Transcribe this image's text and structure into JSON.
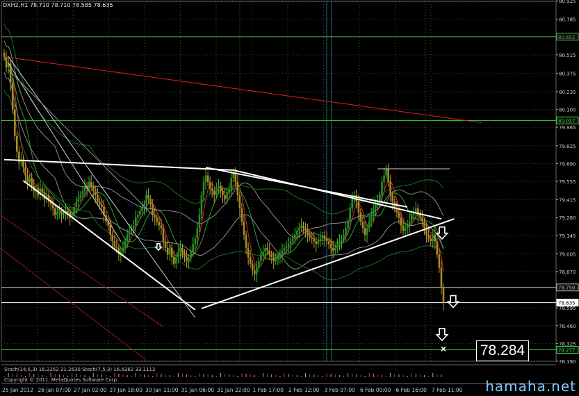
{
  "window": {
    "header": "DXH2,H1  78.710 78.710 78.585 78.635",
    "stoch_label": "Stoch(14,5,3) 16.2252 21.2630   Stoch(7,5,3) 16.6362 33.1112",
    "copyright": "Copyright © 2011, MetaQuotes Software Corp.",
    "watermark": "hamaha.net",
    "callout": "78.284"
  },
  "chart_data": {
    "type": "candlestick",
    "title": "DXH2,H1  78.710 78.710 78.585 78.635",
    "symbol": "DXH2",
    "timeframe": "H1",
    "last_bar": {
      "open": 78.71,
      "high": 78.71,
      "low": 78.585,
      "close": 78.635
    },
    "ylim": [
      78.19,
      80.92
    ],
    "y_ticks": [
      80.925,
      80.785,
      80.515,
      80.375,
      80.235,
      80.1,
      79.965,
      79.825,
      79.69,
      79.555,
      79.415,
      79.28,
      79.145,
      79.005,
      78.87,
      78.595,
      78.46,
      78.325,
      78.19
    ],
    "y_tick_labels": [
      "80.925",
      "80.785",
      "80.515",
      "80.375",
      "80.235",
      "80.100",
      "79.965",
      "79.825",
      "79.690",
      "79.555",
      "79.415",
      "79.280",
      "79.145",
      "79.005",
      "78.870",
      "78.595",
      "78.460",
      "78.325",
      "78.190"
    ],
    "price_markers": [
      {
        "value": 80.652,
        "label": "80.652",
        "color": "#55aa55"
      },
      {
        "value": 80.017,
        "label": "80.017",
        "color": "#33dd33"
      },
      {
        "value": 78.75,
        "label": "78.750",
        "color": "#bbbbbb"
      },
      {
        "value": 78.635,
        "label": "78.635",
        "color": "#ffffff"
      },
      {
        "value": 78.277,
        "label": "78.277",
        "color": "#33dd33"
      }
    ],
    "x_labels": [
      "25 Jan 2012",
      "26 Jan 07:00",
      "27 Jan 02:00",
      "27 Jan 18:00",
      "30 Jan 11:00",
      "31 Jan 06:00",
      "31 Jan 22:00",
      "1 Feb 17:00",
      "2 Feb 12:00",
      "3 Feb 07:00",
      "6 Feb 00:00",
      "6 Feb 16:00",
      "7 Feb 11:00"
    ],
    "bar_count": 206,
    "closes": [
      80.5,
      80.42,
      80.45,
      80.3,
      80.1,
      79.9,
      79.78,
      79.7,
      79.72,
      79.66,
      79.6,
      79.55,
      79.58,
      79.52,
      79.48,
      79.5,
      79.45,
      79.5,
      79.47,
      79.42,
      79.45,
      79.4,
      79.38,
      79.35,
      79.3,
      79.32,
      79.33,
      79.3,
      79.3,
      79.33,
      79.32,
      79.28,
      79.3,
      79.36,
      79.4,
      79.43,
      79.45,
      79.48,
      79.52,
      79.5,
      79.55,
      79.52,
      79.48,
      79.45,
      79.4,
      79.38,
      79.36,
      79.3,
      79.25,
      79.22,
      79.15,
      79.1,
      79.06,
      79.05,
      79.0,
      79.02,
      79.05,
      79.1,
      79.15,
      79.18,
      79.2,
      79.22,
      79.28,
      79.3,
      79.33,
      79.35,
      79.38,
      79.45,
      79.42,
      79.38,
      79.3,
      79.28,
      79.25,
      79.22,
      79.2,
      79.1,
      79.05,
      79.0,
      79.05,
      78.98,
      78.93,
      78.98,
      79.02,
      79.05,
      79.0,
      78.98,
      78.95,
      78.97,
      79.02,
      79.08,
      79.12,
      79.2,
      79.3,
      79.45,
      79.55,
      79.6,
      79.55,
      79.5,
      79.48,
      79.45,
      79.5,
      79.52,
      79.48,
      79.45,
      79.42,
      79.47,
      79.5,
      79.58,
      79.62,
      79.55,
      79.45,
      79.35,
      79.25,
      79.15,
      79.05,
      78.98,
      78.93,
      78.88,
      78.85,
      78.9,
      78.95,
      79.0,
      79.02,
      79.05,
      79.03,
      79.0,
      78.98,
      78.95,
      78.96,
      78.98,
      79.0,
      79.03,
      79.05,
      79.06,
      79.08,
      79.1,
      79.12,
      79.15,
      79.18,
      79.2,
      79.22,
      79.2,
      79.18,
      79.15,
      79.13,
      79.12,
      79.1,
      79.08,
      79.1,
      79.12,
      79.14,
      79.12,
      79.1,
      79.08,
      79.05,
      79.03,
      79.05,
      79.08,
      79.1,
      79.12,
      79.15,
      79.2,
      79.25,
      79.35,
      79.42,
      79.45,
      79.4,
      79.32,
      79.25,
      79.2,
      79.15,
      79.2,
      79.25,
      79.3,
      79.35,
      79.38,
      79.4,
      79.45,
      79.55,
      79.6,
      79.65,
      79.55,
      79.45,
      79.4,
      79.35,
      79.32,
      79.28,
      79.22,
      79.18,
      79.2,
      79.22,
      79.25,
      79.3,
      79.32,
      79.35,
      79.3,
      79.28,
      79.25,
      79.2,
      79.15,
      79.12,
      79.1,
      79.15,
      79.1,
      79.0,
      78.9,
      78.75,
      78.635
    ],
    "trendlines": [
      {
        "from": [
          0,
          79.72
        ],
        "to": [
          108,
          79.64
        ],
        "color": "#ffffff"
      },
      {
        "from": [
          108,
          79.64
        ],
        "to": [
          206,
          79.27
        ],
        "color": "#ffffff"
      },
      {
        "from": [
          9,
          79.56
        ],
        "to": [
          90,
          78.58
        ],
        "color": "#ffffff"
      },
      {
        "from": [
          93,
          78.59
        ],
        "to": [
          212,
          79.27
        ],
        "color": "#ffffff"
      },
      {
        "from": [
          95,
          79.66
        ],
        "to": [
          190,
          79.36
        ],
        "color": "#ffffff"
      },
      {
        "from": [
          0,
          80.5
        ],
        "to": [
          225,
          80.0
        ],
        "color": "#dd2222"
      }
    ],
    "annotations": [
      {
        "type": "arrow_down",
        "label": "⇩",
        "value": 79.15
      },
      {
        "type": "arrow_down",
        "label": "⇩",
        "value": 78.65
      },
      {
        "type": "arrow_down",
        "label": "⇩",
        "value": 78.4
      },
      {
        "type": "target",
        "label": "78.284",
        "value": 78.284
      }
    ]
  }
}
